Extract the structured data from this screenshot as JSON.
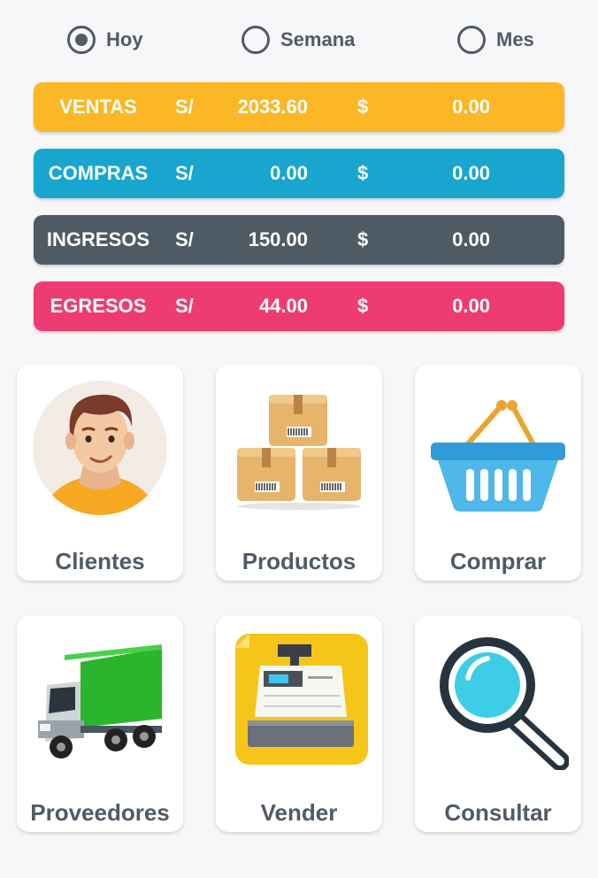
{
  "periods": [
    {
      "label": "Hoy",
      "selected": true
    },
    {
      "label": "Semana",
      "selected": false
    },
    {
      "label": "Mes",
      "selected": false
    }
  ],
  "summary": [
    {
      "label": "VENTAS",
      "currency_local": "S/",
      "amount_local": "2033.60",
      "currency_usd": "$",
      "amount_usd": "0.00",
      "color": "#fbb726"
    },
    {
      "label": "COMPRAS",
      "currency_local": "S/",
      "amount_local": "0.00",
      "currency_usd": "$",
      "amount_usd": "0.00",
      "color": "#18a6cf"
    },
    {
      "label": "INGRESOS",
      "currency_local": "S/",
      "amount_local": "150.00",
      "currency_usd": "$",
      "amount_usd": "0.00",
      "color": "#4e5b64"
    },
    {
      "label": "EGRESOS",
      "currency_local": "S/",
      "amount_local": "44.00",
      "currency_usd": "$",
      "amount_usd": "0.00",
      "color": "#ef3b74"
    }
  ],
  "menu": [
    {
      "label": "Clientes",
      "icon": "customer-avatar-icon"
    },
    {
      "label": "Productos",
      "icon": "product-boxes-icon"
    },
    {
      "label": "Comprar",
      "icon": "shopping-basket-icon"
    },
    {
      "label": "Proveedores",
      "icon": "delivery-truck-icon"
    },
    {
      "label": "Vender",
      "icon": "cash-register-icon"
    },
    {
      "label": "Consultar",
      "icon": "magnifier-icon"
    }
  ]
}
